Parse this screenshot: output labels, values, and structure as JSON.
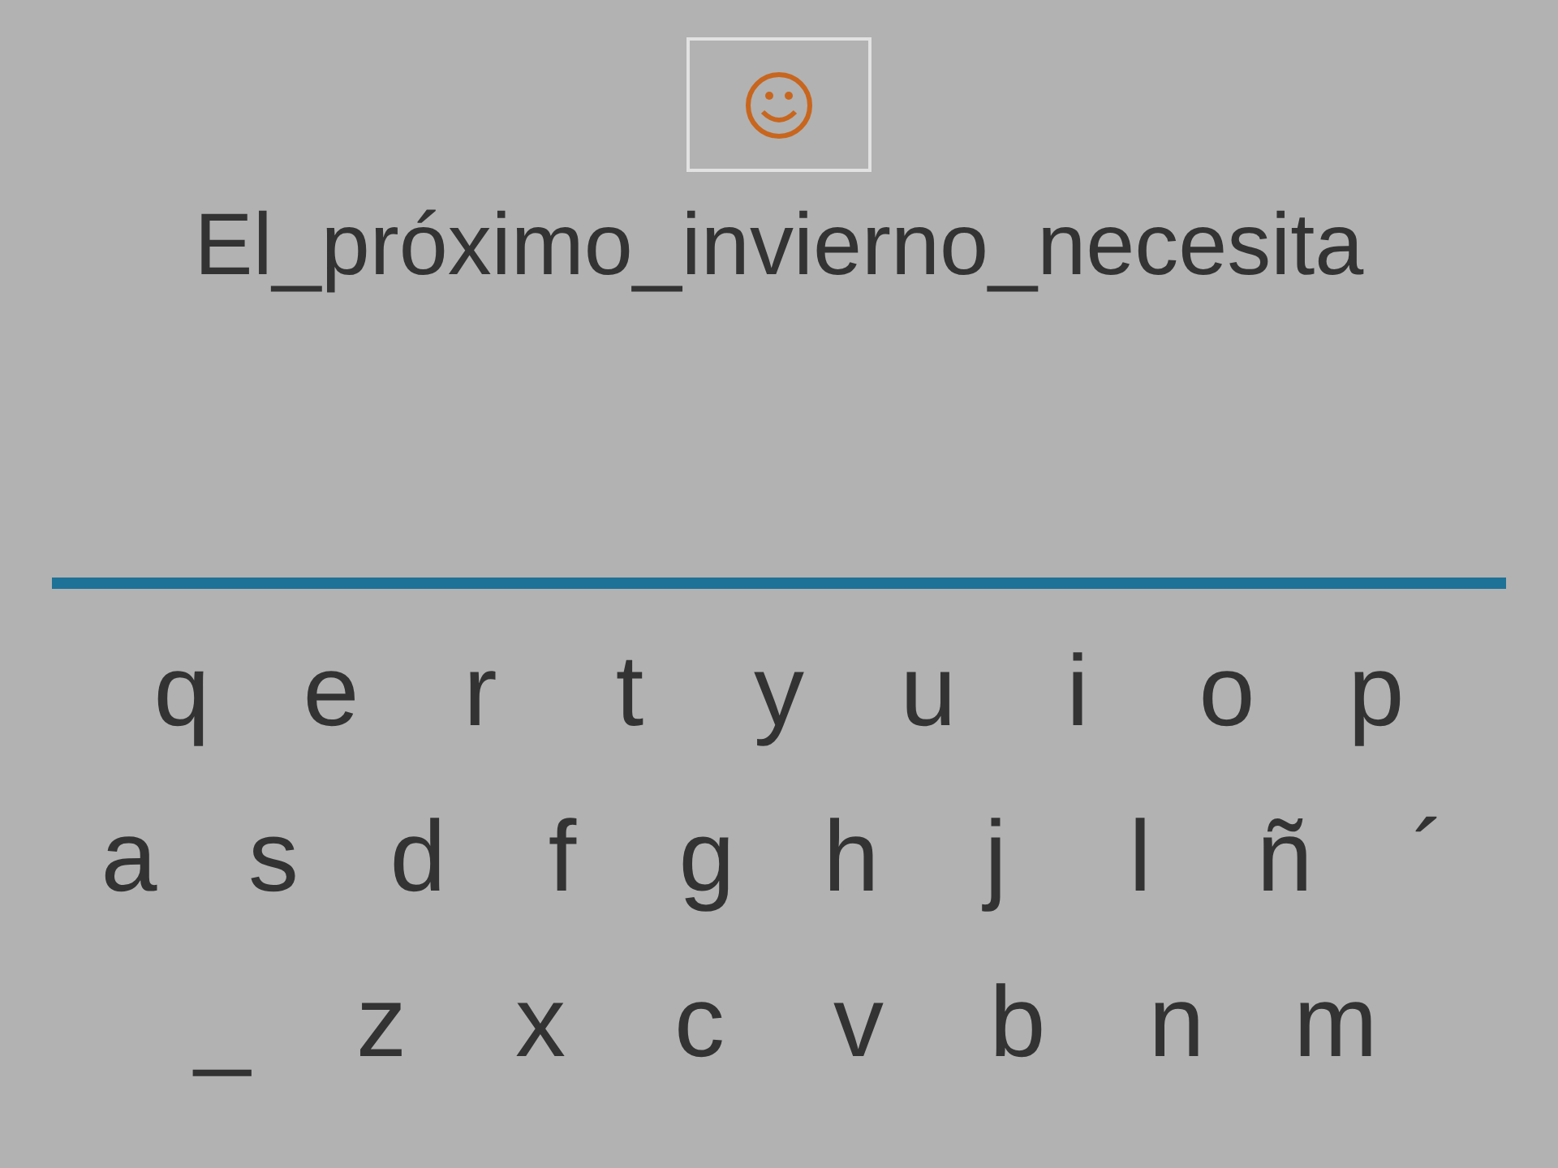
{
  "phrase": "El_próximo_invierno_necesita",
  "keyboard": [
    [
      "q",
      "e",
      "r",
      "t",
      "y",
      "u",
      "i",
      "o",
      "p"
    ],
    [
      "a",
      "s",
      "d",
      "f",
      "g",
      "h",
      "j",
      "l",
      "ñ",
      "´"
    ],
    [
      "_",
      "z",
      "x",
      "c",
      "v",
      "b",
      "n",
      "m"
    ]
  ]
}
